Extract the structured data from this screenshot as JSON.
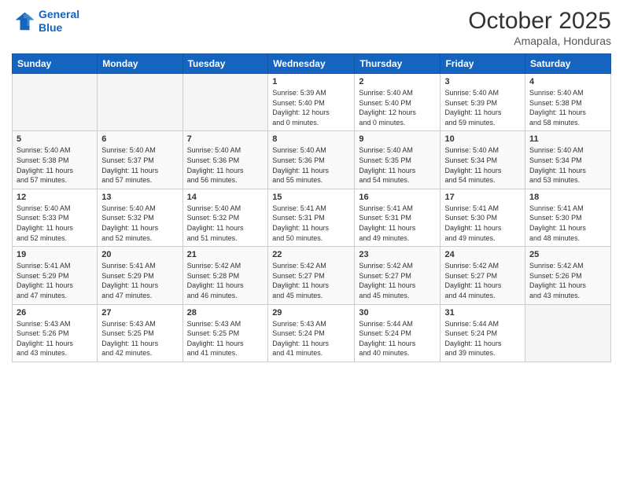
{
  "header": {
    "logo_line1": "General",
    "logo_line2": "Blue",
    "month": "October 2025",
    "location": "Amapala, Honduras"
  },
  "weekdays": [
    "Sunday",
    "Monday",
    "Tuesday",
    "Wednesday",
    "Thursday",
    "Friday",
    "Saturday"
  ],
  "weeks": [
    [
      {
        "day": "",
        "info": ""
      },
      {
        "day": "",
        "info": ""
      },
      {
        "day": "",
        "info": ""
      },
      {
        "day": "1",
        "info": "Sunrise: 5:39 AM\nSunset: 5:40 PM\nDaylight: 12 hours\nand 0 minutes."
      },
      {
        "day": "2",
        "info": "Sunrise: 5:40 AM\nSunset: 5:40 PM\nDaylight: 12 hours\nand 0 minutes."
      },
      {
        "day": "3",
        "info": "Sunrise: 5:40 AM\nSunset: 5:39 PM\nDaylight: 11 hours\nand 59 minutes."
      },
      {
        "day": "4",
        "info": "Sunrise: 5:40 AM\nSunset: 5:38 PM\nDaylight: 11 hours\nand 58 minutes."
      }
    ],
    [
      {
        "day": "5",
        "info": "Sunrise: 5:40 AM\nSunset: 5:38 PM\nDaylight: 11 hours\nand 57 minutes."
      },
      {
        "day": "6",
        "info": "Sunrise: 5:40 AM\nSunset: 5:37 PM\nDaylight: 11 hours\nand 57 minutes."
      },
      {
        "day": "7",
        "info": "Sunrise: 5:40 AM\nSunset: 5:36 PM\nDaylight: 11 hours\nand 56 minutes."
      },
      {
        "day": "8",
        "info": "Sunrise: 5:40 AM\nSunset: 5:36 PM\nDaylight: 11 hours\nand 55 minutes."
      },
      {
        "day": "9",
        "info": "Sunrise: 5:40 AM\nSunset: 5:35 PM\nDaylight: 11 hours\nand 54 minutes."
      },
      {
        "day": "10",
        "info": "Sunrise: 5:40 AM\nSunset: 5:34 PM\nDaylight: 11 hours\nand 54 minutes."
      },
      {
        "day": "11",
        "info": "Sunrise: 5:40 AM\nSunset: 5:34 PM\nDaylight: 11 hours\nand 53 minutes."
      }
    ],
    [
      {
        "day": "12",
        "info": "Sunrise: 5:40 AM\nSunset: 5:33 PM\nDaylight: 11 hours\nand 52 minutes."
      },
      {
        "day": "13",
        "info": "Sunrise: 5:40 AM\nSunset: 5:32 PM\nDaylight: 11 hours\nand 52 minutes."
      },
      {
        "day": "14",
        "info": "Sunrise: 5:40 AM\nSunset: 5:32 PM\nDaylight: 11 hours\nand 51 minutes."
      },
      {
        "day": "15",
        "info": "Sunrise: 5:41 AM\nSunset: 5:31 PM\nDaylight: 11 hours\nand 50 minutes."
      },
      {
        "day": "16",
        "info": "Sunrise: 5:41 AM\nSunset: 5:31 PM\nDaylight: 11 hours\nand 49 minutes."
      },
      {
        "day": "17",
        "info": "Sunrise: 5:41 AM\nSunset: 5:30 PM\nDaylight: 11 hours\nand 49 minutes."
      },
      {
        "day": "18",
        "info": "Sunrise: 5:41 AM\nSunset: 5:30 PM\nDaylight: 11 hours\nand 48 minutes."
      }
    ],
    [
      {
        "day": "19",
        "info": "Sunrise: 5:41 AM\nSunset: 5:29 PM\nDaylight: 11 hours\nand 47 minutes."
      },
      {
        "day": "20",
        "info": "Sunrise: 5:41 AM\nSunset: 5:29 PM\nDaylight: 11 hours\nand 47 minutes."
      },
      {
        "day": "21",
        "info": "Sunrise: 5:42 AM\nSunset: 5:28 PM\nDaylight: 11 hours\nand 46 minutes."
      },
      {
        "day": "22",
        "info": "Sunrise: 5:42 AM\nSunset: 5:27 PM\nDaylight: 11 hours\nand 45 minutes."
      },
      {
        "day": "23",
        "info": "Sunrise: 5:42 AM\nSunset: 5:27 PM\nDaylight: 11 hours\nand 45 minutes."
      },
      {
        "day": "24",
        "info": "Sunrise: 5:42 AM\nSunset: 5:27 PM\nDaylight: 11 hours\nand 44 minutes."
      },
      {
        "day": "25",
        "info": "Sunrise: 5:42 AM\nSunset: 5:26 PM\nDaylight: 11 hours\nand 43 minutes."
      }
    ],
    [
      {
        "day": "26",
        "info": "Sunrise: 5:43 AM\nSunset: 5:26 PM\nDaylight: 11 hours\nand 43 minutes."
      },
      {
        "day": "27",
        "info": "Sunrise: 5:43 AM\nSunset: 5:25 PM\nDaylight: 11 hours\nand 42 minutes."
      },
      {
        "day": "28",
        "info": "Sunrise: 5:43 AM\nSunset: 5:25 PM\nDaylight: 11 hours\nand 41 minutes."
      },
      {
        "day": "29",
        "info": "Sunrise: 5:43 AM\nSunset: 5:24 PM\nDaylight: 11 hours\nand 41 minutes."
      },
      {
        "day": "30",
        "info": "Sunrise: 5:44 AM\nSunset: 5:24 PM\nDaylight: 11 hours\nand 40 minutes."
      },
      {
        "day": "31",
        "info": "Sunrise: 5:44 AM\nSunset: 5:24 PM\nDaylight: 11 hours\nand 39 minutes."
      },
      {
        "day": "",
        "info": ""
      }
    ]
  ]
}
